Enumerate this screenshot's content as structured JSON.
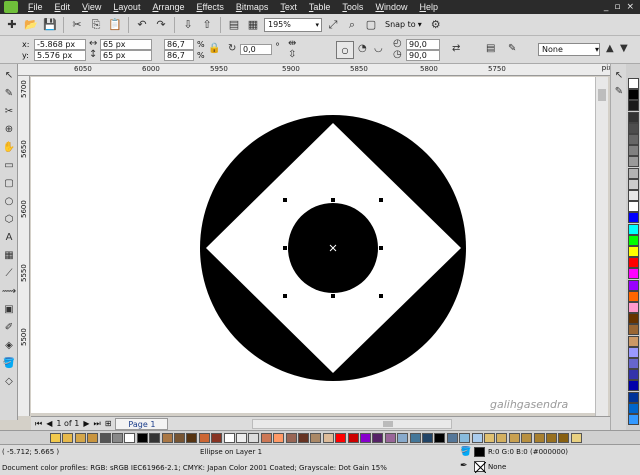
{
  "menu": {
    "items": [
      "File",
      "Edit",
      "View",
      "Layout",
      "Arrange",
      "Effects",
      "Bitmaps",
      "Text",
      "Table",
      "Tools",
      "Window",
      "Help"
    ],
    "window_controls": [
      "_",
      "▫",
      "×"
    ]
  },
  "toolbar": {
    "zoom_value": "195%",
    "snap_label": "Snap to"
  },
  "property_bar": {
    "x_label": "x:",
    "x_value": "-5.868 px",
    "y_label": "y:",
    "y_value": "5.576 px",
    "width_value": "65 px",
    "height_value": "65 px",
    "scale_x": "86,7",
    "scale_y": "86,7",
    "pct": "%",
    "rotation_value": "0,0",
    "angle_start": "90,0",
    "angle_end": "90,0",
    "outline_value": "None"
  },
  "ruler": {
    "h_ticks": [
      "6050",
      "6000",
      "5950",
      "5900",
      "5850",
      "5800",
      "5750"
    ],
    "v_ticks": [
      "5700",
      "5650",
      "5600",
      "5550",
      "5500"
    ],
    "units": "pixels"
  },
  "page_nav": {
    "page_count": "1 of 1",
    "page_tab": "Page 1"
  },
  "status": {
    "coords": "( -5.712; 5.665 )",
    "selection": "Ellipse on Layer 1",
    "profiles": "Document color profiles: RGB: sRGB IEC61966-2.1; CMYK: Japan Color 2001 Coated; Grayscale: Dot Gain 15%",
    "fill": "R:0 G:0 B:0 (#000000)",
    "outline": "None"
  },
  "watermark": "galihgasendra",
  "colors": {
    "menubar": "#2b2b2b",
    "toolbar": "#dcdcdc",
    "fill": "#000000"
  },
  "palette_v": [
    "#ffffff",
    "#000000",
    "#1a1a1a",
    "#333333",
    "#4d4d4d",
    "#666666",
    "#808080",
    "#999999",
    "#b3b3b3",
    "#cccccc",
    "#e6e6e6",
    "#ffffff",
    "#0000ff",
    "#00ffff",
    "#00ff00",
    "#ffff00",
    "#ff0000",
    "#ff00ff",
    "#9900ff",
    "#ff6600",
    "#ff99cc",
    "#663300",
    "#996633",
    "#cc9966",
    "#9999ff",
    "#6666cc",
    "#3333aa",
    "#0000aa",
    "#003399",
    "#0066cc",
    "#3399ff"
  ],
  "palette_h": [
    "#f2c94c",
    "#e6b84a",
    "#d4a64a",
    "#c9953f",
    "#555555",
    "#888888",
    "#ffffff",
    "#000000",
    "#333333",
    "#aa7744",
    "#775533",
    "#553311",
    "#cc6633",
    "#883322",
    "#ffffff",
    "#eeeeee",
    "#dddddd",
    "#cc7755",
    "#ff9966",
    "#996655",
    "#663322",
    "#aa8866",
    "#ddbb99",
    "#ff0000",
    "#cc0000",
    "#8800cc",
    "#552266",
    "#996699",
    "#88aacc",
    "#447799",
    "#224466",
    "#000000",
    "#557799",
    "#88bbdd",
    "#aaccee",
    "#e0c070",
    "#d4b060",
    "#c8a050",
    "#b89040",
    "#a88030",
    "#987020",
    "#886010",
    "#e8d080"
  ],
  "tools": [
    "↖",
    "✎",
    "✂",
    "⊕",
    "✋",
    "▭",
    "▢",
    "○",
    "⬡",
    "A",
    "▦",
    "⟋",
    "⟿",
    "▣",
    "✐",
    "◈",
    "🪣",
    "◇"
  ]
}
